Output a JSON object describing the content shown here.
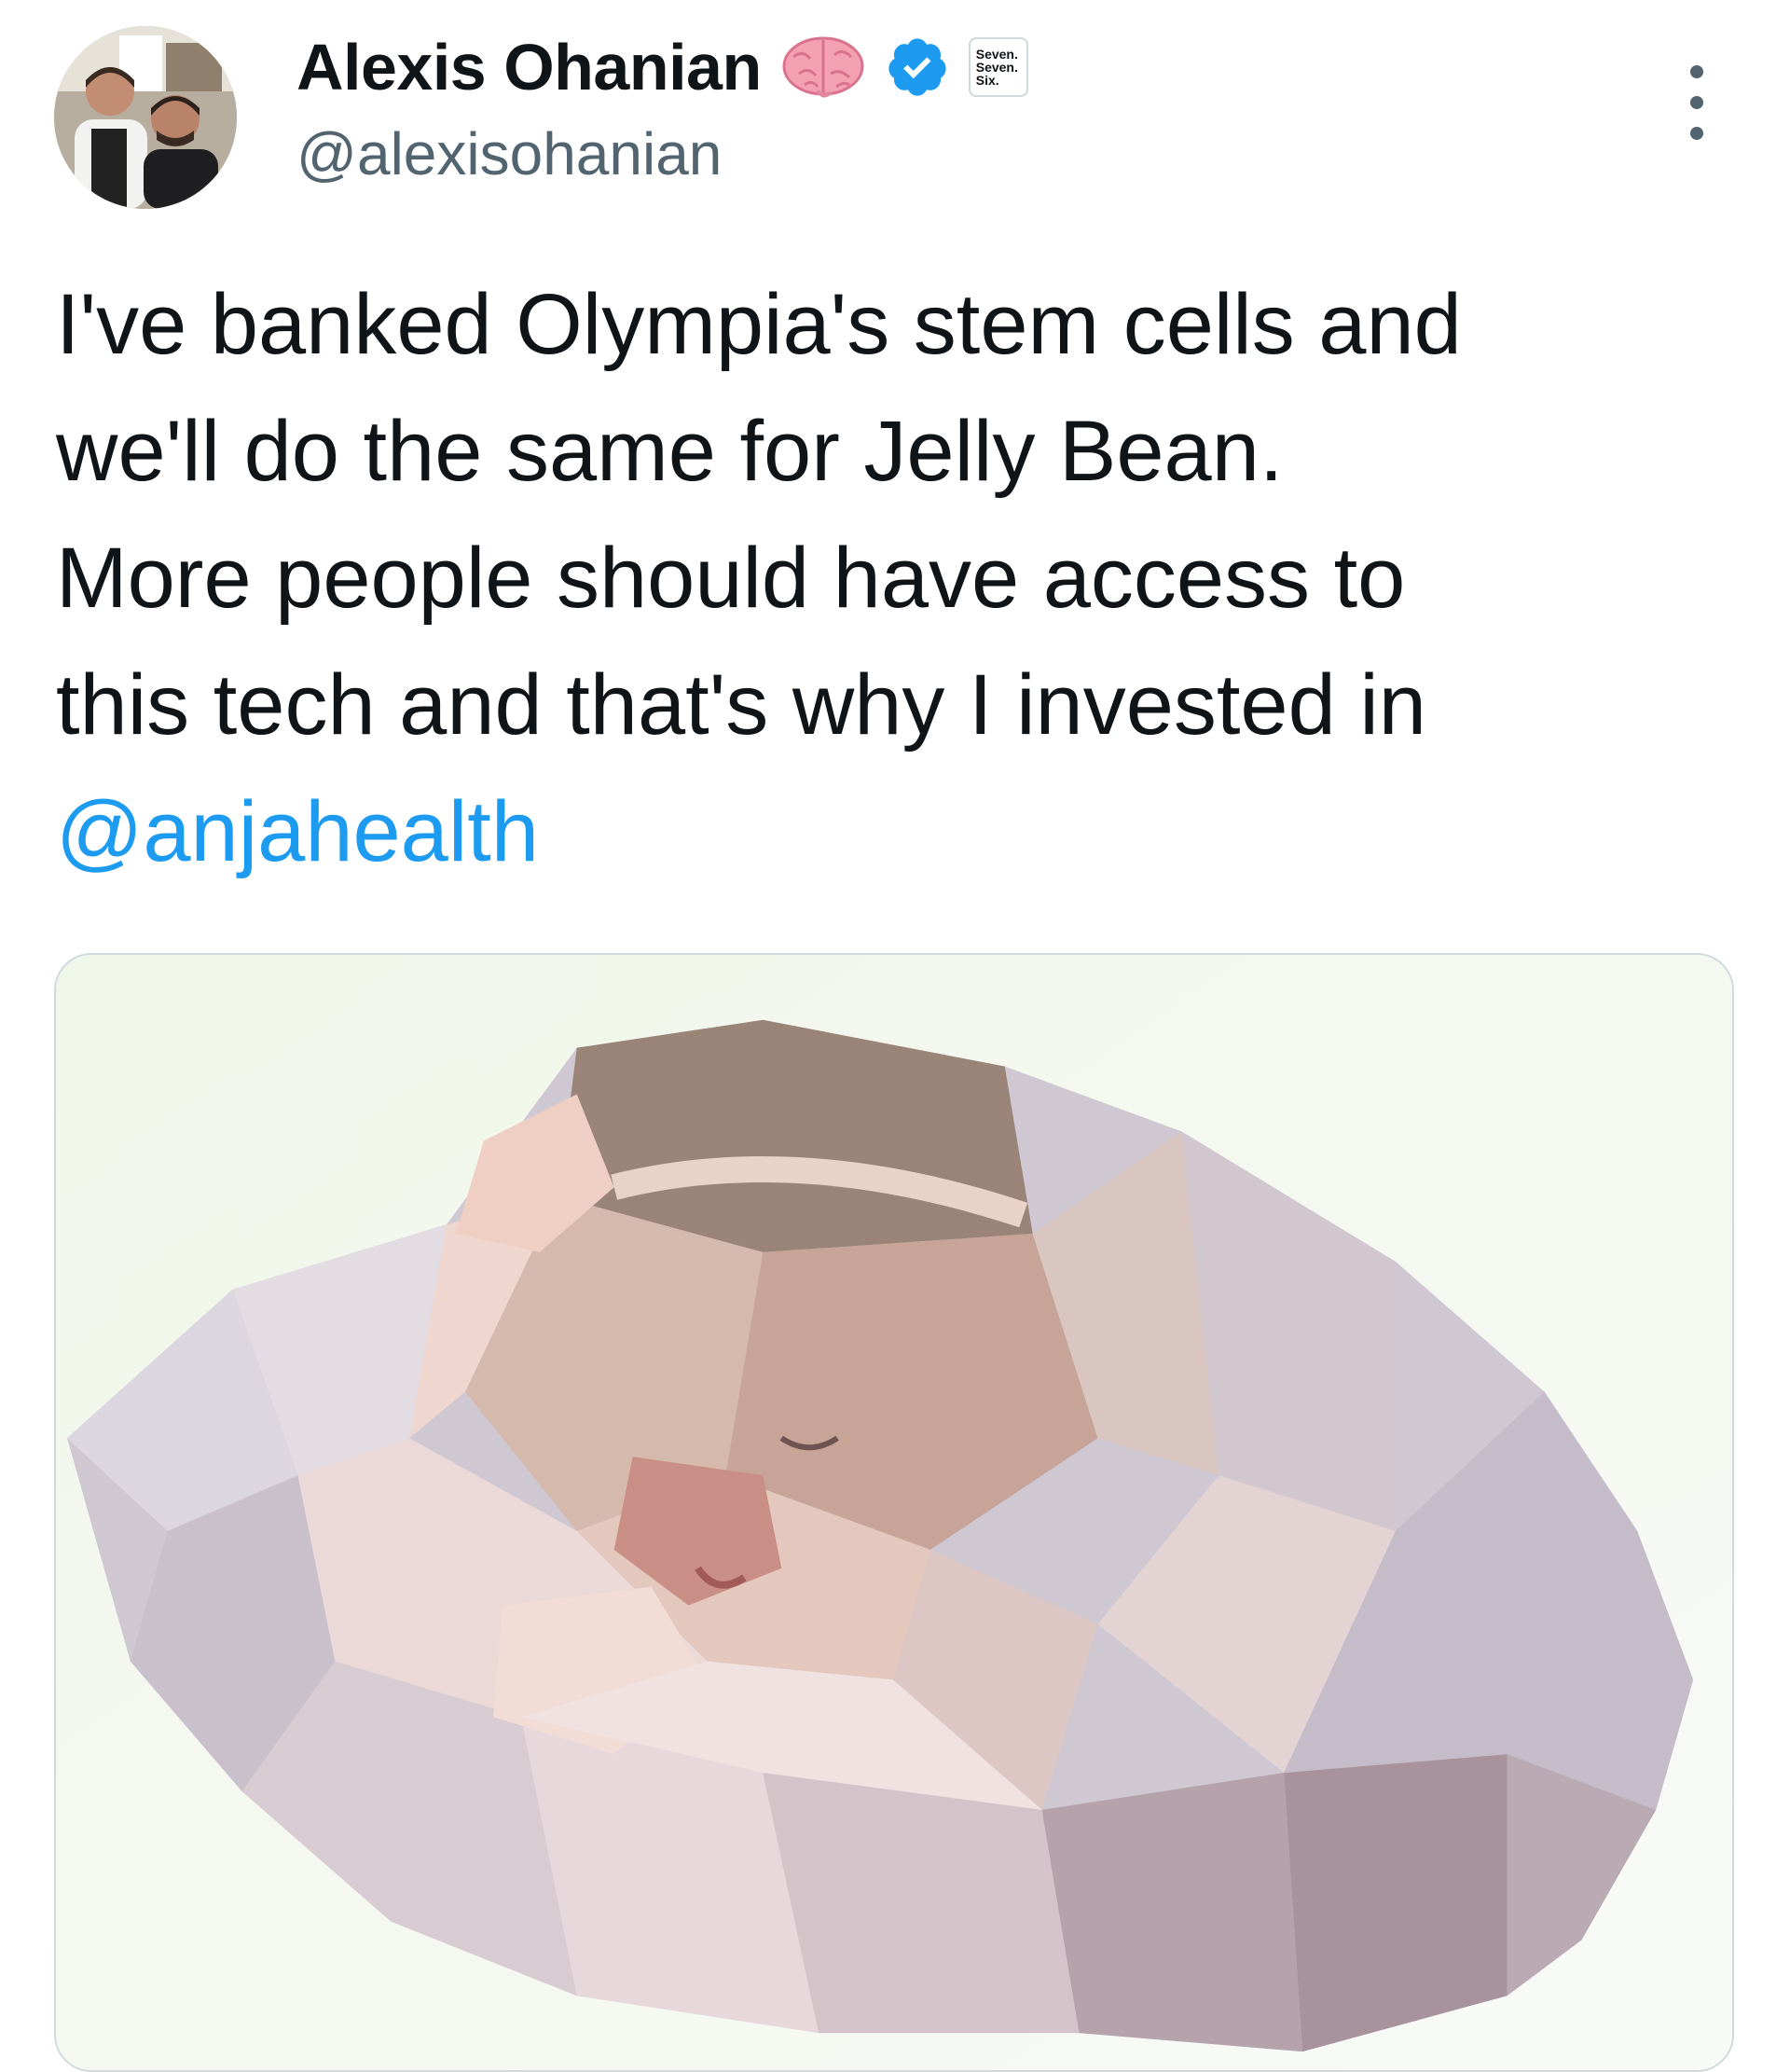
{
  "tweet": {
    "author": {
      "display_name": "Alexis Ohanian",
      "handle": "@alexisohanian",
      "emoji_icon": "brain-icon",
      "verified": true,
      "verified_color": "#1d9bf0",
      "affiliate_badge": [
        "Seven.",
        "Seven.",
        "Six."
      ]
    },
    "text_lines": [
      "I've banked Olympia's stem cells and",
      "we'll do the same for Jelly Bean.",
      "More people should have access to",
      "this tech and that's why I invested in"
    ],
    "mention": "@anjahealth",
    "link_color": "#1d9bf0",
    "media": {
      "type": "image",
      "icon": "low-poly-sleeping-baby-illustration"
    }
  }
}
